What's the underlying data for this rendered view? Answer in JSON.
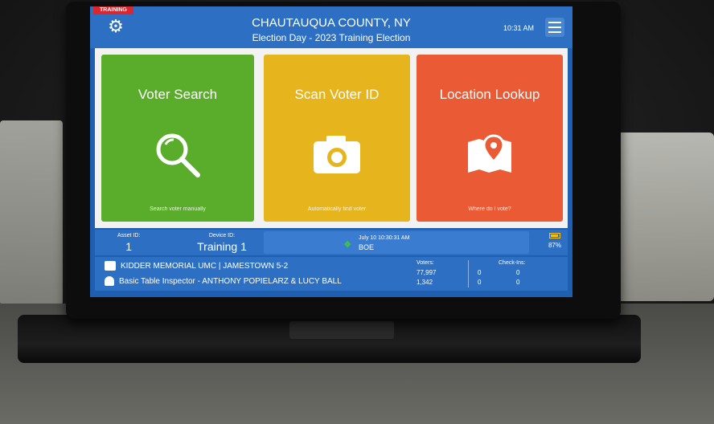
{
  "header": {
    "training_badge": "TRAINING",
    "county": "CHAUTAUQUA COUNTY, NY",
    "election": "Election Day - 2023 Training Election",
    "time": "10:31 AM"
  },
  "tiles": [
    {
      "label": "Voter Search",
      "subtitle": "Search voter manually",
      "icon": "magnifier-icon"
    },
    {
      "label": "Scan Voter ID",
      "subtitle": "Automatically find voter",
      "icon": "camera-icon"
    },
    {
      "label": "Location Lookup",
      "subtitle": "Where do I vote?",
      "icon": "map-pin-icon"
    }
  ],
  "info": {
    "asset_label": "Asset ID:",
    "asset_value": "1",
    "device_label": "Device ID:",
    "device_value": "Training 1",
    "sync_time": "July 10 10:30:31 AM",
    "sync_source": "BOE",
    "battery": "87%"
  },
  "footer": {
    "location": "KIDDER MEMORIAL UMC | JAMESTOWN 5-2",
    "inspector": "Basic Table Inspector - ANTHONY POPIELARZ & LUCY BALL",
    "voters_label": "Voters:",
    "voters_total": "77,997",
    "voters_local": "1,342",
    "checkins_label": "Check-Ins:",
    "checkin_a": "0",
    "checkin_b": "0",
    "checkin_c": "0",
    "checkin_d": "0"
  },
  "colors": {
    "header": "#2d6fc2",
    "green": "#5aad2a",
    "yellow": "#e6b41c",
    "orange": "#ea5a35"
  }
}
